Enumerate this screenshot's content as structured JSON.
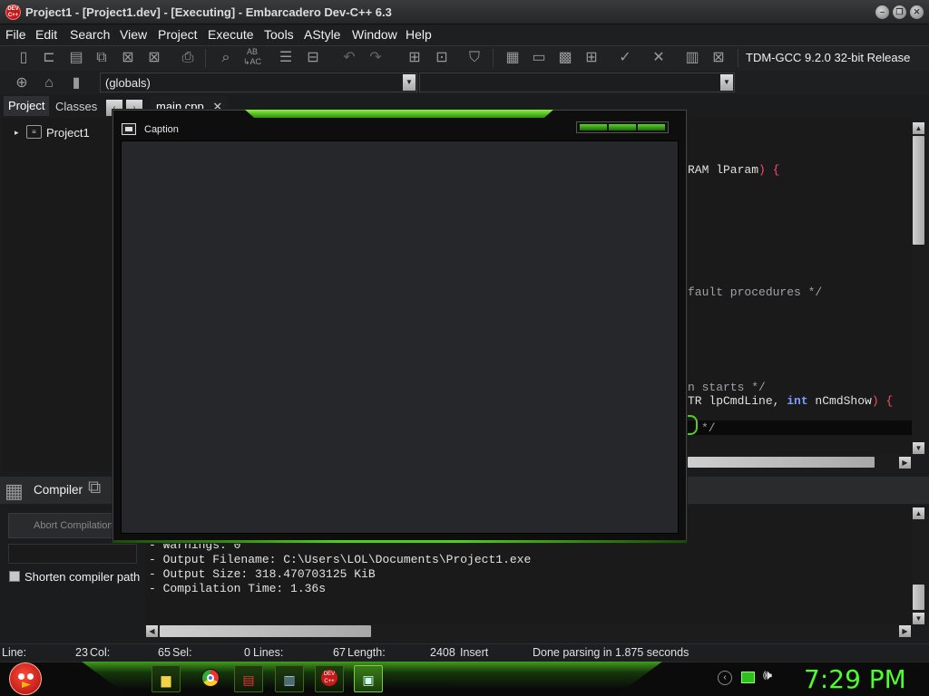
{
  "window": {
    "title": "Project1 - [Project1.dev] - [Executing] - Embarcadero Dev-C++ 6.3",
    "app_icon_text": "DEV C++",
    "controls": [
      "minimize",
      "restore",
      "close"
    ]
  },
  "menu": [
    "File",
    "Edit",
    "Search",
    "View",
    "Project",
    "Execute",
    "Tools",
    "AStyle",
    "Window",
    "Help"
  ],
  "toolbar": {
    "compiler": "TDM-GCC 9.2.0 32-bit Release",
    "scope_combo": "(globals)"
  },
  "left_panel": {
    "tabs": [
      "Project",
      "Classes"
    ],
    "tree_root": "Project1"
  },
  "editor": {
    "tab_label": "main.cpp",
    "visible_code_fragments": [
      "RAM lParam) {",
      "fault procedures */",
      "n starts */",
      "TR lpCmdLine, int nCmdShow) {",
      "*/"
    ]
  },
  "running_app": {
    "caption": "Caption"
  },
  "bottom_panel": {
    "tab_label": "Compiler",
    "abort_label": "Abort Compilation",
    "shorten_label": "Shorten compiler path",
    "output_lines": [
      "- Warnings: 0",
      "- Output Filename: C:\\Users\\LOL\\Documents\\Project1.exe",
      "- Output Size: 318.470703125 KiB",
      "- Compilation Time: 1.36s"
    ]
  },
  "status": {
    "line_label": "Line:",
    "line_value": "23",
    "col_label": "Col:",
    "col_value": "65",
    "sel_label": "Sel:",
    "sel_value": "0",
    "lines_label": "Lines:",
    "lines_value": "67",
    "length_label": "Length:",
    "length_value": "2408",
    "mode": "Insert",
    "message": "Done parsing in 1.875 seconds"
  },
  "taskbar": {
    "clock": "7:29 PM",
    "apps": [
      "folder-icon",
      "chrome-icon",
      "calendar-icon",
      "notepad-icon",
      "devcpp-icon",
      "window-icon"
    ]
  },
  "colors": {
    "accent_green": "#4cff2a",
    "keyword_blue": "#7d9cff",
    "paren_red": "#ff4a6a"
  }
}
